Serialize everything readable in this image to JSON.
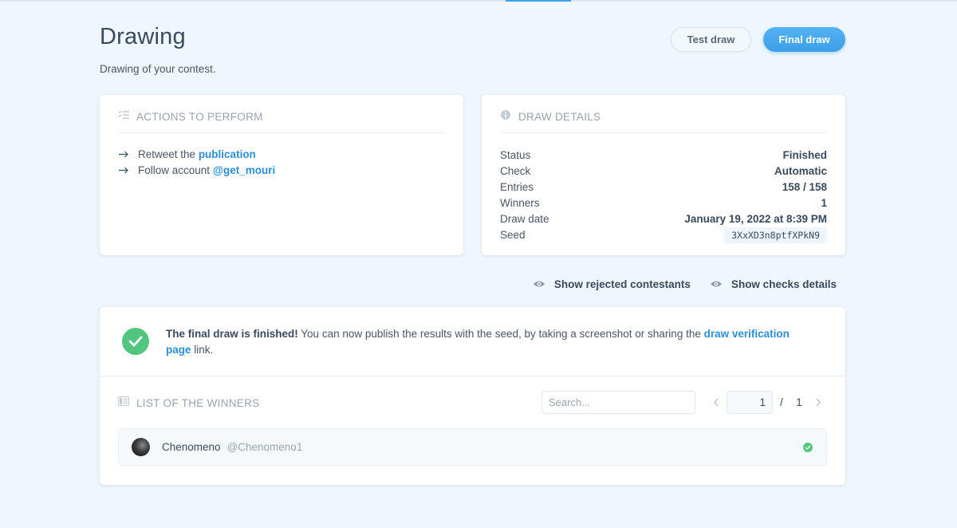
{
  "header": {
    "title": "Drawing",
    "subtitle": "Drawing of your contest.",
    "test_draw_label": "Test draw",
    "final_draw_label": "Final draw"
  },
  "actions": {
    "title": "ACTIONS TO PERFORM",
    "items": [
      {
        "prefix": "Retweet the",
        "link": "publication"
      },
      {
        "prefix": "Follow account",
        "link": "@get_mouri"
      }
    ]
  },
  "details": {
    "title": "DRAW DETAILS",
    "rows": [
      {
        "key": "Status",
        "value": "Finished"
      },
      {
        "key": "Check",
        "value": "Automatic"
      },
      {
        "key": "Entries",
        "value": "158 / 158"
      },
      {
        "key": "Winners",
        "value": "1"
      },
      {
        "key": "Draw date",
        "value": "January 19, 2022 at 8:39 PM"
      },
      {
        "key": "Seed",
        "value": "3XxXD3n8ptfXPkN9"
      }
    ]
  },
  "toggles": {
    "rejected": "Show rejected contestants",
    "checks": "Show checks details"
  },
  "result": {
    "notice_bold": "The final draw is finished!",
    "notice_text": " You can now publish the results with the seed, by taking a screenshot or sharing the ",
    "notice_link": "draw verification page",
    "notice_end": " link."
  },
  "winners": {
    "title": "LIST OF THE WINNERS",
    "search_placeholder": "Search...",
    "page_current": "1",
    "page_sep": "/",
    "page_total": "1",
    "list": [
      {
        "name": "Chenomeno",
        "handle": "@Chenomeno1"
      }
    ]
  },
  "colors": {
    "accent": "#3ba3ea",
    "link": "#2a8fd6",
    "success": "#52c57f",
    "background": "#eff6fc"
  }
}
